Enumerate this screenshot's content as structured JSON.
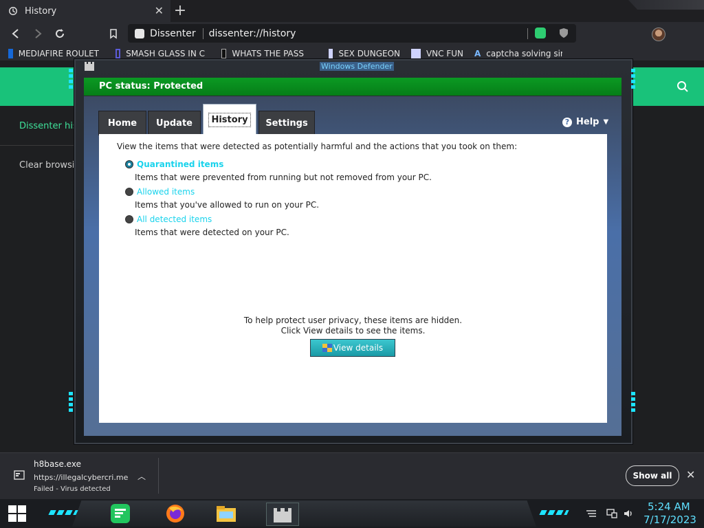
{
  "browser": {
    "tab": {
      "title": "History",
      "close": "✕"
    },
    "new_tab": "+",
    "omnibox": {
      "site_name": "Dissenter",
      "url": "dissenter://history"
    },
    "menu": "☰",
    "bookmarks": [
      {
        "label": "MEDIAFIRE ROULET",
        "icon": "mediafire-icon"
      },
      {
        "label": "SMASH GLASS IN C",
        "icon": "glass-icon"
      },
      {
        "label": "WHATS THE PASS",
        "icon": "lock-icon"
      },
      {
        "label": "SEX DUNGEON",
        "icon": "cube-icon"
      },
      {
        "label": "VNC FUN",
        "icon": "cube-icon"
      },
      {
        "label": "captcha solving sim",
        "icon": "letter-a-icon"
      }
    ]
  },
  "page": {
    "side_items": [
      "Dissenter his",
      "Clear browsi"
    ]
  },
  "defender": {
    "window_title": "Windows Defender",
    "status": "PC status: Protected",
    "tabs": [
      "Home",
      "Update",
      "History",
      "Settings"
    ],
    "active_tab": "History",
    "help": "Help",
    "description": "View the items that were detected as potentially harmful and the actions that you took on them:",
    "options": [
      {
        "label": "Quarantined items",
        "sub": "Items that were prevented from running but not removed from your PC.",
        "selected": true
      },
      {
        "label": "Allowed items",
        "sub": "Items that you've allowed to run on your PC.",
        "selected": false
      },
      {
        "label": "All detected items",
        "sub": "Items that were detected on your PC.",
        "selected": false
      }
    ],
    "privacy_line1": "To help protect user privacy, these items are hidden.",
    "privacy_line2": "Click View details to see the items.",
    "view_details": "View details"
  },
  "download": {
    "file_name": "h8base.exe",
    "source": "https://illegalcybercri.me",
    "status": "Failed - Virus detected",
    "show_all": "Show all",
    "close": "✕"
  },
  "taskbar": {
    "time": "5:24 AM",
    "date": "7/17/2023"
  },
  "colors": {
    "accent_green": "#19c27a",
    "status_green": "#0b9a23",
    "cyan": "#1de3ff",
    "link_cyan": "#19d3ec"
  }
}
